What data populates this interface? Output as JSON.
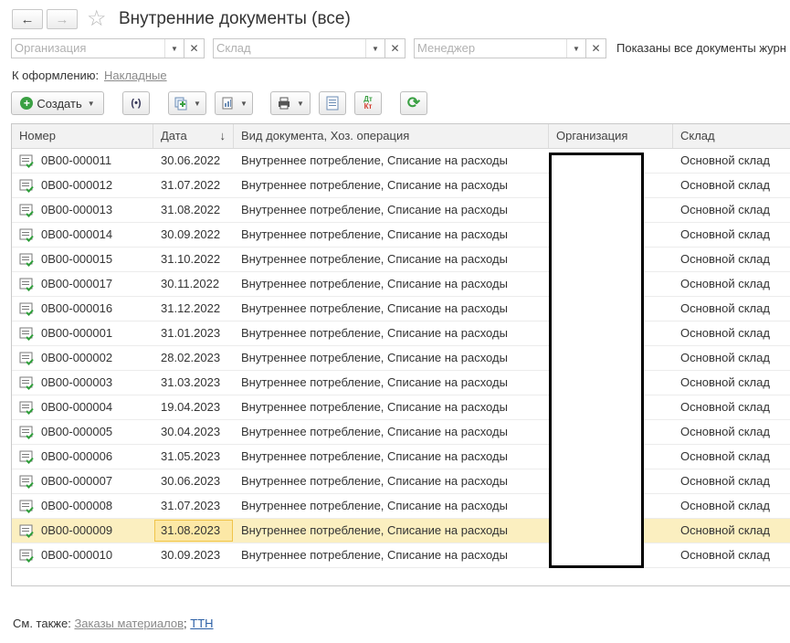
{
  "header": {
    "back_label": "←",
    "forward_label": "→",
    "star_label": "☆",
    "title": "Внутренние документы (все)"
  },
  "filters": {
    "organization_placeholder": "Организация",
    "warehouse_placeholder": "Склад",
    "manager_placeholder": "Менеджер",
    "status_text": "Показаны все документы журн"
  },
  "pending": {
    "label": "К оформлению:",
    "link": "Накладные"
  },
  "toolbar": {
    "create_label": "Создать"
  },
  "table": {
    "columns": [
      "Номер",
      "Дата",
      "Вид документа, Хоз. операция",
      "Организация",
      "Склад"
    ],
    "sort_indicator": "↓",
    "rows": [
      {
        "number": "0В00-000011",
        "date": "30.06.2022",
        "kind": "Внутреннее потребление, Списание на расходы",
        "org": "",
        "warehouse": "Основной склад"
      },
      {
        "number": "0В00-000012",
        "date": "31.07.2022",
        "kind": "Внутреннее потребление, Списание на расходы",
        "org": "",
        "warehouse": "Основной склад"
      },
      {
        "number": "0В00-000013",
        "date": "31.08.2022",
        "kind": "Внутреннее потребление, Списание на расходы",
        "org": "",
        "warehouse": "Основной склад"
      },
      {
        "number": "0В00-000014",
        "date": "30.09.2022",
        "kind": "Внутреннее потребление, Списание на расходы",
        "org": "",
        "warehouse": "Основной склад"
      },
      {
        "number": "0В00-000015",
        "date": "31.10.2022",
        "kind": "Внутреннее потребление, Списание на расходы",
        "org": "",
        "warehouse": "Основной склад"
      },
      {
        "number": "0В00-000017",
        "date": "30.11.2022",
        "kind": "Внутреннее потребление, Списание на расходы",
        "org": "",
        "warehouse": "Основной склад"
      },
      {
        "number": "0В00-000016",
        "date": "31.12.2022",
        "kind": "Внутреннее потребление, Списание на расходы",
        "org": "",
        "warehouse": "Основной склад"
      },
      {
        "number": "0В00-000001",
        "date": "31.01.2023",
        "kind": "Внутреннее потребление, Списание на расходы",
        "org": "",
        "warehouse": "Основной склад"
      },
      {
        "number": "0В00-000002",
        "date": "28.02.2023",
        "kind": "Внутреннее потребление, Списание на расходы",
        "org": "",
        "warehouse": "Основной склад"
      },
      {
        "number": "0В00-000003",
        "date": "31.03.2023",
        "kind": "Внутреннее потребление, Списание на расходы",
        "org": "",
        "warehouse": "Основной склад"
      },
      {
        "number": "0В00-000004",
        "date": "19.04.2023",
        "kind": "Внутреннее потребление, Списание на расходы",
        "org": "",
        "warehouse": "Основной склад"
      },
      {
        "number": "0В00-000005",
        "date": "30.04.2023",
        "kind": "Внутреннее потребление, Списание на расходы",
        "org": "",
        "warehouse": "Основной склад"
      },
      {
        "number": "0В00-000006",
        "date": "31.05.2023",
        "kind": "Внутреннее потребление, Списание на расходы",
        "org": "",
        "warehouse": "Основной склад"
      },
      {
        "number": "0В00-000007",
        "date": "30.06.2023",
        "kind": "Внутреннее потребление, Списание на расходы",
        "org": "",
        "warehouse": "Основной склад"
      },
      {
        "number": "0В00-000008",
        "date": "31.07.2023",
        "kind": "Внутреннее потребление, Списание на расходы",
        "org": "",
        "warehouse": "Основной склад"
      },
      {
        "number": "0В00-000009",
        "date": "31.08.2023",
        "kind": "Внутреннее потребление, Списание на расходы",
        "org": "",
        "warehouse": "Основной склад",
        "selected": true
      },
      {
        "number": "0В00-000010",
        "date": "30.09.2023",
        "kind": "Внутреннее потребление, Списание на расходы",
        "org": "",
        "warehouse": "Основной склад"
      }
    ]
  },
  "footer": {
    "label": "См. также:",
    "link_materials": "Заказы материалов",
    "separator": ";",
    "link_ttn": "ТТН"
  },
  "colors": {
    "selected_row": "#fbefc0",
    "link_blue": "#2b5fa5",
    "create_icon": "#3aa043",
    "refresh_icon": "#3aa043"
  }
}
